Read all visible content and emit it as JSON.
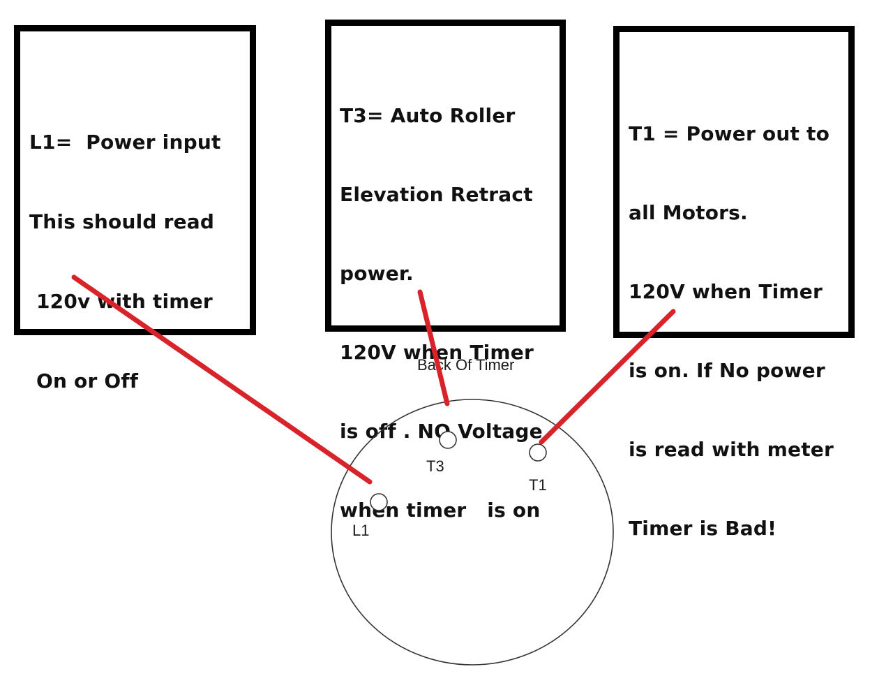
{
  "notes": {
    "l1": {
      "lines": [
        "L1=  Power input",
        "This should read",
        " 120v with timer",
        " On or Off"
      ]
    },
    "t3": {
      "lines": [
        "T3= Auto Roller",
        "Elevation Retract",
        "power.",
        "120V when Timer",
        "is off . NO Voltage",
        "when timer   is on"
      ]
    },
    "t1": {
      "lines": [
        "T1 = Power out to",
        "all Motors.",
        "120V when Timer",
        "is on. If No power",
        "is read with meter",
        "Timer is Bad!"
      ]
    }
  },
  "timer": {
    "title": "Back Of Timer",
    "terminals": {
      "l1": "L1",
      "t3": "T3",
      "t1": "T1"
    }
  },
  "colors": {
    "leader_line": "#d8232a",
    "box_border": "#000000",
    "outline": "#333333"
  }
}
